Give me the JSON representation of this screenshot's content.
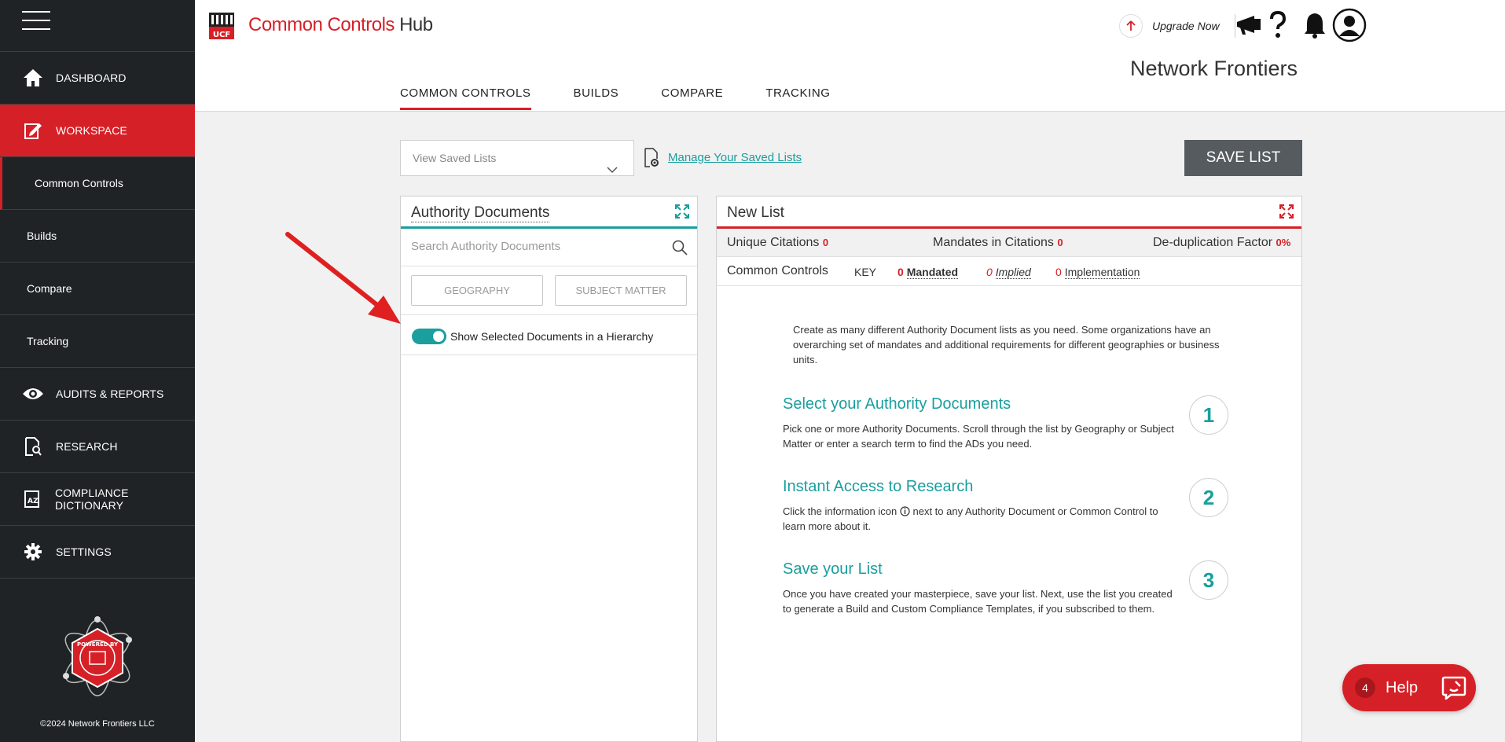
{
  "app": {
    "logo_text": "Common Controls",
    "logo_hub": "Hub",
    "logo_badge": "UCF",
    "company": "Network Frontiers",
    "upgrade_label": "Upgrade Now"
  },
  "sidebar": {
    "items": [
      {
        "label": "DASHBOARD",
        "icon": "home-icon"
      },
      {
        "label": "WORKSPACE",
        "icon": "edit-icon"
      },
      {
        "label": "Common Controls"
      },
      {
        "label": "Builds"
      },
      {
        "label": "Compare"
      },
      {
        "label": "Tracking"
      },
      {
        "label": "AUDITS & REPORTS",
        "icon": "eye-icon"
      },
      {
        "label": "RESEARCH",
        "icon": "research-icon"
      },
      {
        "label": "COMPLIANCE DICTIONARY",
        "icon": "dictionary-icon"
      },
      {
        "label": "SETTINGS",
        "icon": "gear-icon"
      }
    ],
    "copyright": "©2024 Network Frontiers LLC",
    "badge_text": "POWERED BY"
  },
  "tabs": [
    "COMMON CONTROLS",
    "BUILDS",
    "COMPARE",
    "TRACKING"
  ],
  "controls": {
    "saved_lists_placeholder": "View Saved Lists",
    "manage_link": "Manage Your Saved Lists",
    "save_button": "SAVE LIST"
  },
  "authority_panel": {
    "title": "Authority Documents",
    "search_placeholder": "Search Authority Documents",
    "filter_geography": "GEOGRAPHY",
    "filter_subject": "SUBJECT MATTER",
    "toggle_label": "Show Selected Documents in a Hierarchy",
    "toggle_on": true
  },
  "new_list": {
    "title": "New List",
    "unique_citations_label": "Unique Citations",
    "unique_citations": "0",
    "mandates_label": "Mandates in Citations",
    "mandates": "0",
    "dedup_label": "De-duplication Factor",
    "dedup": "0%",
    "common_controls_label": "Common Controls",
    "key_label": "KEY",
    "mandated_count": "0",
    "mandated_label": "Mandated",
    "implied_count": "0",
    "implied_label": "Implied",
    "implementation_count": "0",
    "implementation_label": "Implementation",
    "intro": "Create as many different Authority Document lists as you need. Some organizations have an overarching set of mandates and additional requirements for different geographies or business units.",
    "steps": [
      {
        "num": "1",
        "title": "Select your Authority Documents",
        "desc": "Pick one or more Authority Documents. Scroll through the list by Geography or Subject Matter or enter a search term to find the ADs you need."
      },
      {
        "num": "2",
        "title": "Instant Access to Research",
        "desc_a": "Click the information icon",
        "desc_b": "next to any Authority Document or Common Control to learn more about it."
      },
      {
        "num": "3",
        "title": "Save your List",
        "desc": "Once you have created your masterpiece, save your list. Next, use the list you created to generate a Build and Custom Compliance Templates, if you subscribed to them."
      }
    ]
  },
  "help": {
    "count": "4",
    "label": "Help"
  },
  "colors": {
    "brand_red": "#d62027",
    "teal": "#1a9e9e",
    "sidebar_bg": "#1f2326"
  }
}
